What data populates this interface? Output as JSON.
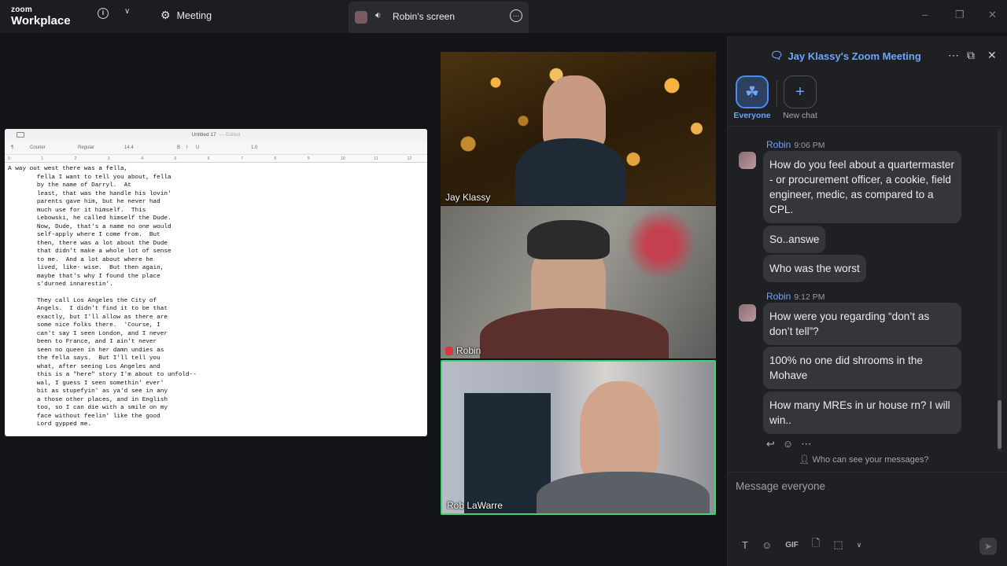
{
  "app": {
    "brand_top": "zoom",
    "brand_bottom": "Workplace",
    "meeting_label": "Meeting",
    "screen_tab_label": "Robin's screen"
  },
  "shared_doc": {
    "title": "Untitled 17",
    "edited": "— Edited",
    "toolbar": [
      "¶",
      "Courier",
      "Regular",
      "14.4",
      "B",
      "I",
      "U",
      "1.0"
    ],
    "ruler": [
      "0",
      "1",
      "2",
      "3",
      "4",
      "5",
      "6",
      "7",
      "8",
      "9",
      "10",
      "11",
      "12"
    ],
    "lines": [
      "A way out west there was a fella,",
      "        fella I want to tell you about, fella",
      "        by the name of Darryl.  At",
      "        least, that was the handle his lovin'",
      "        parents gave him, but he never had",
      "        much use for it himself.  This",
      "        Lebowski, he called himself the Dude.",
      "        Now, Dude, that's a name no one would",
      "        self-apply where I come from.  But",
      "        then, there was a lot about the Dude",
      "        that didn't make a whole lot of sense",
      "        to me.  And a lot about where he",
      "        lived, like- wise.  But then again,",
      "        maybe that's why I found the place",
      "        s'durned innarestin'.",
      "",
      "        They call Los Angeles the City of",
      "        Angels.  I didn't find it to be that",
      "        exactly, but I'll allow as there are",
      "        some nice folks there.  'Course, I",
      "        can't say I seen London, and I never",
      "        been to France, and I ain't never",
      "        seen no queen in her damn undies as",
      "        the fella says.  But I'll tell you",
      "        what, after seeing Los Angeles and",
      "        this is a \"here\" story I'm about to unfold--",
      "        wal, I guess I seen somethin' ever'",
      "        bit as stupefyin' as ya'd see in any",
      "        a those other places, and in English",
      "        too, so I can die with a smile on my",
      "        face without feelin' like the good",
      "        Lord gypped me."
    ]
  },
  "participants": [
    {
      "name": "Jay Klassy"
    },
    {
      "name": "Robin"
    },
    {
      "name": "Rob LaWarre"
    }
  ],
  "chat": {
    "title": "Jay Klassy's Zoom Meeting",
    "channels": [
      {
        "label": "Everyone"
      },
      {
        "label": "New chat"
      }
    ],
    "groups": [
      {
        "sender": "Robin",
        "time": "9:06 PM",
        "messages": [
          "How do you feel about a quartermaster - or procurement officer, a cookie, field engineer, medic, as compared to a CPL.",
          "So..answe",
          "Who was the worst"
        ]
      },
      {
        "sender": "Robin",
        "time": "9:12 PM",
        "messages": [
          "How were you regarding “don’t as don’t tell”?",
          "100% no one did shrooms in the Mohave",
          "How many MREs in ur house rn? I will win.."
        ]
      }
    ],
    "who_can_see": "Who can see your messages?",
    "input_placeholder": "Message everyone",
    "gif_label": "GIF"
  },
  "colors": {
    "accent": "#6ea5f7",
    "active_speaker": "#42d27a",
    "background": "#131417"
  }
}
